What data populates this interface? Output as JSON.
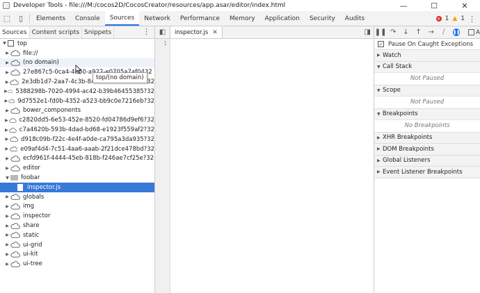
{
  "window": {
    "title": "Developer Tools - file:///M:/cocos2D/CocosCreator/resources/app.asar/editor/index.html",
    "controls": [
      "—",
      "☐",
      "✕"
    ]
  },
  "toolbar": {
    "tabs": [
      "Elements",
      "Console",
      "Sources",
      "Network",
      "Performance",
      "Memory",
      "Application",
      "Security",
      "Audits"
    ],
    "active_tab": "Sources",
    "error_count": "1",
    "warning_count": "1"
  },
  "navigator": {
    "subtabs": [
      "Sources",
      "Content scripts",
      "Snippets"
    ],
    "tree": [
      {
        "label": "top",
        "kind": "frame",
        "depth": 0,
        "expanded": true
      },
      {
        "label": "file://",
        "kind": "cloud",
        "depth": 1
      },
      {
        "label": "(no domain)",
        "kind": "cloud",
        "depth": 1,
        "hover": true
      },
      {
        "label": "27e867c5-0ca4-4b50-a922-e0705a7af0432",
        "kind": "cloud",
        "depth": 1
      },
      {
        "label": "2e3db1d7-2aa7-4c3b-849b-f5ee15530e6?32",
        "kind": "cloud",
        "depth": 1
      },
      {
        "label": "5388298b-7020-4994-ac42-b39b46455385?32",
        "kind": "cloud",
        "depth": 1
      },
      {
        "label": "9d7552e1-fd0b-4352-a523-bb9c0e7216eb?32",
        "kind": "cloud",
        "depth": 1
      },
      {
        "label": "bower_components",
        "kind": "cloud",
        "depth": 1
      },
      {
        "label": "c2820dd5-6e53-452e-8520-fd04786d9ef6?32",
        "kind": "cloud",
        "depth": 1
      },
      {
        "label": "c7a4620b-593b-4dad-bd68-e1923f559af2?32",
        "kind": "cloud",
        "depth": 1
      },
      {
        "label": "d918c09b-f22c-4e4f-a0de-ca795a3da935?32",
        "kind": "cloud",
        "depth": 1
      },
      {
        "label": "e09af4d4-7c51-4aa6-aaab-2f21dce478bd?32",
        "kind": "cloud",
        "depth": 1
      },
      {
        "label": "ecfd961f-4444-45eb-818b-f246ae7cf25e?32",
        "kind": "cloud",
        "depth": 1
      },
      {
        "label": "editor",
        "kind": "cloud",
        "depth": 1
      },
      {
        "label": "foobar",
        "kind": "folder",
        "depth": 1,
        "expanded": true
      },
      {
        "label": "inspector.js",
        "kind": "file",
        "depth": 2,
        "selected": true
      },
      {
        "label": "globals",
        "kind": "cloud",
        "depth": 1
      },
      {
        "label": "img",
        "kind": "cloud",
        "depth": 1
      },
      {
        "label": "inspector",
        "kind": "cloud",
        "depth": 1
      },
      {
        "label": "share",
        "kind": "cloud",
        "depth": 1
      },
      {
        "label": "static",
        "kind": "cloud",
        "depth": 1
      },
      {
        "label": "ui-grid",
        "kind": "cloud",
        "depth": 1
      },
      {
        "label": "ui-kit",
        "kind": "cloud",
        "depth": 1
      },
      {
        "label": "ui-tree",
        "kind": "cloud",
        "depth": 1
      }
    ],
    "tooltip": "top/(no domain)"
  },
  "editor": {
    "open_tab": "inspector.js",
    "line_numbers": [
      "1"
    ]
  },
  "debugger": {
    "pause_on_caught": "Pause On Caught Exceptions",
    "async_label": "A",
    "sections": [
      {
        "title": "Watch",
        "expanded": false,
        "body": ""
      },
      {
        "title": "Call Stack",
        "expanded": true,
        "body": "Not Paused"
      },
      {
        "title": "Scope",
        "expanded": true,
        "body": "Not Paused"
      },
      {
        "title": "Breakpoints",
        "expanded": true,
        "body": "No Breakpoints"
      },
      {
        "title": "XHR Breakpoints",
        "expanded": false,
        "body": ""
      },
      {
        "title": "DOM Breakpoints",
        "expanded": false,
        "body": ""
      },
      {
        "title": "Global Listeners",
        "expanded": false,
        "body": ""
      },
      {
        "title": "Event Listener Breakpoints",
        "expanded": false,
        "body": ""
      }
    ]
  }
}
